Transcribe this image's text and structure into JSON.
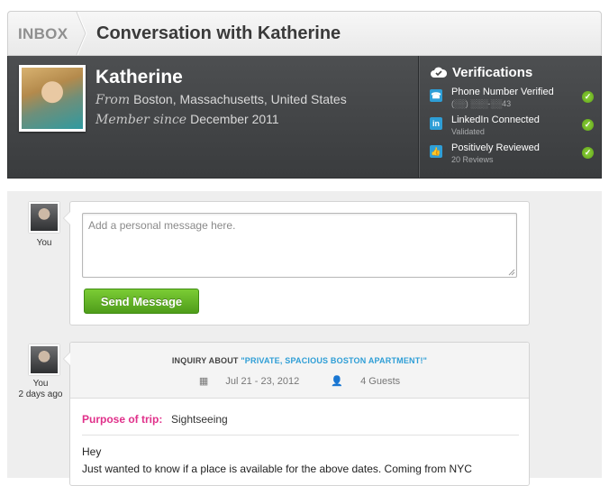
{
  "header": {
    "breadcrumb": "INBOX",
    "title": "Conversation with Katherine"
  },
  "profile": {
    "name": "Katherine",
    "from_label": "From",
    "location": "Boston, Massachusetts, United States",
    "member_label": "Member since",
    "member_since": "December 2011"
  },
  "verifications": {
    "title": "Verifications",
    "items": [
      {
        "label": "Phone Number Verified",
        "sub": "(░░) ░░░-░░43",
        "icon": "phone-icon"
      },
      {
        "label": "LinkedIn Connected",
        "sub": "Validated",
        "icon": "linkedin-icon"
      },
      {
        "label": "Positively Reviewed",
        "sub": "20 Reviews",
        "icon": "thumbs-up-icon"
      }
    ]
  },
  "compose": {
    "author": "You",
    "placeholder": "Add a personal message here.",
    "send_label": "Send Message"
  },
  "message": {
    "author": "You",
    "time": "2 days ago",
    "inquiry_prefix": "INQUIRY ABOUT ",
    "property": "\"PRIVATE, SPACIOUS BOSTON APARTMENT!\"",
    "dates": "Jul 21 - 23, 2012",
    "guests": "4 Guests",
    "purpose_label": "Purpose of trip:",
    "purpose_value": "Sightseeing",
    "body": [
      "Hey",
      "Just wanted to know if a place is available for the above dates. Coming from NYC"
    ]
  },
  "colors": {
    "accent_blue": "#2e9ed6",
    "send_green": "#5fa317",
    "purpose_pink": "#e0308a",
    "profile_bg": "#434547"
  }
}
